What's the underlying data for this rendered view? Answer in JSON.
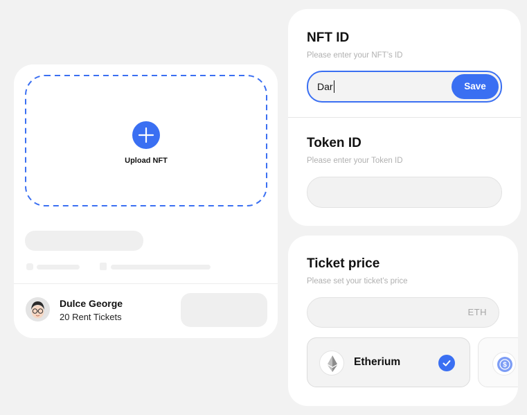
{
  "upload": {
    "label": "Upload NFT"
  },
  "user": {
    "name": "Dulce George",
    "tickets": "20 Rent Tickets"
  },
  "nft_id": {
    "title": "NFT ID",
    "subtitle": "Please enter your NFT’s ID",
    "value": "Dar",
    "save_label": "Save"
  },
  "token_id": {
    "title": "Token ID",
    "subtitle": "Please enter your Token ID",
    "value": ""
  },
  "ticket_price": {
    "title": "Ticket price",
    "subtitle": "Please set your ticket’s price",
    "currency": "ETH",
    "options": [
      {
        "label": "Etherium",
        "icon": "ethereum-icon",
        "selected": true
      },
      {
        "label": "",
        "icon": "usdc-icon",
        "selected": false
      }
    ]
  },
  "colors": {
    "accent": "#3a6ff2",
    "background": "#f2f2f2",
    "card": "#ffffff",
    "placeholder": "#b0b0b0"
  }
}
